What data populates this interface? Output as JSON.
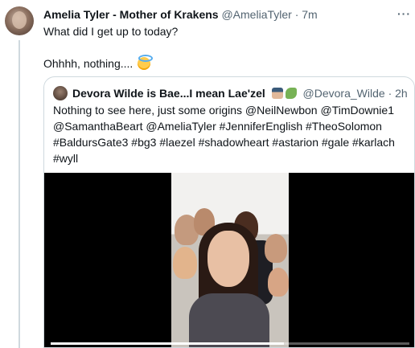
{
  "tweet": {
    "author_name": "Amelia Tyler - Mother of Krakens",
    "author_handle": "@AmeliaTyler",
    "separator": "·",
    "time": "7m",
    "text": "What did I get up to today?",
    "text_line2": "Ohhhh, nothing....",
    "line2_emoji": "smiling-face-with-halo-icon"
  },
  "quote": {
    "author_name": "Devora Wilde is Bae...I mean Lae'zel",
    "author_emojis": [
      "woman-astronaut-icon",
      "dragon-icon"
    ],
    "author_handle": "@Devora_Wilde",
    "separator": "·",
    "time": "2h",
    "text": "Nothing to see here, just some origins @NeilNewbon @TimDownie1 @SamanthaBeart @AmeliaTyler #JenniferEnglish #TheoSolomon #BaldursGate3 #bg3 #laezel #shadowheart #astarion #gale #karlach #wyll",
    "video_progress": 0.65
  },
  "colors": {
    "text": "#0f1419",
    "secondary_text": "#536471",
    "border": "#cfd9de",
    "media_background": "#000000"
  }
}
